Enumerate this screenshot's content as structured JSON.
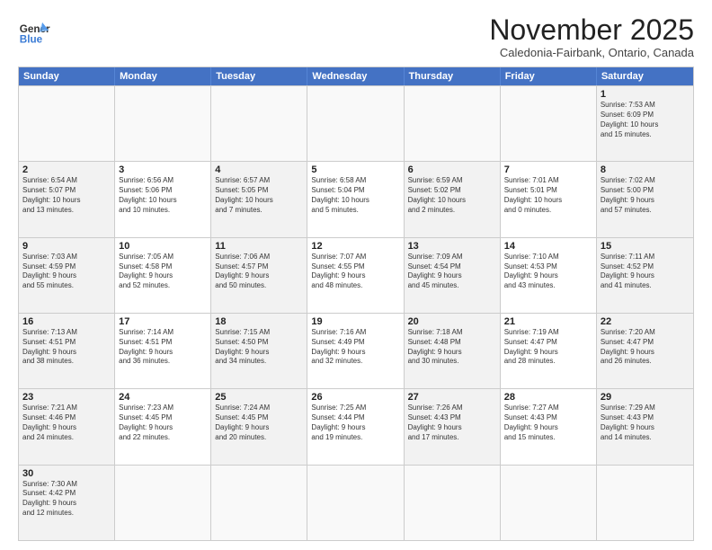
{
  "header": {
    "logo_general": "General",
    "logo_blue": "Blue",
    "month_title": "November 2025",
    "location": "Caledonia-Fairbank, Ontario, Canada"
  },
  "days_of_week": [
    "Sunday",
    "Monday",
    "Tuesday",
    "Wednesday",
    "Thursday",
    "Friday",
    "Saturday"
  ],
  "weeks": [
    [
      {
        "day": "",
        "info": "",
        "empty": true
      },
      {
        "day": "",
        "info": "",
        "empty": true
      },
      {
        "day": "",
        "info": "",
        "empty": true
      },
      {
        "day": "",
        "info": "",
        "empty": true
      },
      {
        "day": "",
        "info": "",
        "empty": true
      },
      {
        "day": "",
        "info": "",
        "empty": true
      },
      {
        "day": "1",
        "info": "Sunrise: 7:53 AM\nSunset: 6:09 PM\nDaylight: 10 hours\nand 15 minutes."
      }
    ],
    [
      {
        "day": "2",
        "info": "Sunrise: 6:54 AM\nSunset: 5:07 PM\nDaylight: 10 hours\nand 13 minutes."
      },
      {
        "day": "3",
        "info": "Sunrise: 6:56 AM\nSunset: 5:06 PM\nDaylight: 10 hours\nand 10 minutes."
      },
      {
        "day": "4",
        "info": "Sunrise: 6:57 AM\nSunset: 5:05 PM\nDaylight: 10 hours\nand 7 minutes."
      },
      {
        "day": "5",
        "info": "Sunrise: 6:58 AM\nSunset: 5:04 PM\nDaylight: 10 hours\nand 5 minutes."
      },
      {
        "day": "6",
        "info": "Sunrise: 6:59 AM\nSunset: 5:02 PM\nDaylight: 10 hours\nand 2 minutes."
      },
      {
        "day": "7",
        "info": "Sunrise: 7:01 AM\nSunset: 5:01 PM\nDaylight: 10 hours\nand 0 minutes."
      },
      {
        "day": "8",
        "info": "Sunrise: 7:02 AM\nSunset: 5:00 PM\nDaylight: 9 hours\nand 57 minutes."
      }
    ],
    [
      {
        "day": "9",
        "info": "Sunrise: 7:03 AM\nSunset: 4:59 PM\nDaylight: 9 hours\nand 55 minutes."
      },
      {
        "day": "10",
        "info": "Sunrise: 7:05 AM\nSunset: 4:58 PM\nDaylight: 9 hours\nand 52 minutes."
      },
      {
        "day": "11",
        "info": "Sunrise: 7:06 AM\nSunset: 4:57 PM\nDaylight: 9 hours\nand 50 minutes."
      },
      {
        "day": "12",
        "info": "Sunrise: 7:07 AM\nSunset: 4:55 PM\nDaylight: 9 hours\nand 48 minutes."
      },
      {
        "day": "13",
        "info": "Sunrise: 7:09 AM\nSunset: 4:54 PM\nDaylight: 9 hours\nand 45 minutes."
      },
      {
        "day": "14",
        "info": "Sunrise: 7:10 AM\nSunset: 4:53 PM\nDaylight: 9 hours\nand 43 minutes."
      },
      {
        "day": "15",
        "info": "Sunrise: 7:11 AM\nSunset: 4:52 PM\nDaylight: 9 hours\nand 41 minutes."
      }
    ],
    [
      {
        "day": "16",
        "info": "Sunrise: 7:13 AM\nSunset: 4:51 PM\nDaylight: 9 hours\nand 38 minutes."
      },
      {
        "day": "17",
        "info": "Sunrise: 7:14 AM\nSunset: 4:51 PM\nDaylight: 9 hours\nand 36 minutes."
      },
      {
        "day": "18",
        "info": "Sunrise: 7:15 AM\nSunset: 4:50 PM\nDaylight: 9 hours\nand 34 minutes."
      },
      {
        "day": "19",
        "info": "Sunrise: 7:16 AM\nSunset: 4:49 PM\nDaylight: 9 hours\nand 32 minutes."
      },
      {
        "day": "20",
        "info": "Sunrise: 7:18 AM\nSunset: 4:48 PM\nDaylight: 9 hours\nand 30 minutes."
      },
      {
        "day": "21",
        "info": "Sunrise: 7:19 AM\nSunset: 4:47 PM\nDaylight: 9 hours\nand 28 minutes."
      },
      {
        "day": "22",
        "info": "Sunrise: 7:20 AM\nSunset: 4:47 PM\nDaylight: 9 hours\nand 26 minutes."
      }
    ],
    [
      {
        "day": "23",
        "info": "Sunrise: 7:21 AM\nSunset: 4:46 PM\nDaylight: 9 hours\nand 24 minutes."
      },
      {
        "day": "24",
        "info": "Sunrise: 7:23 AM\nSunset: 4:45 PM\nDaylight: 9 hours\nand 22 minutes."
      },
      {
        "day": "25",
        "info": "Sunrise: 7:24 AM\nSunset: 4:45 PM\nDaylight: 9 hours\nand 20 minutes."
      },
      {
        "day": "26",
        "info": "Sunrise: 7:25 AM\nSunset: 4:44 PM\nDaylight: 9 hours\nand 19 minutes."
      },
      {
        "day": "27",
        "info": "Sunrise: 7:26 AM\nSunset: 4:43 PM\nDaylight: 9 hours\nand 17 minutes."
      },
      {
        "day": "28",
        "info": "Sunrise: 7:27 AM\nSunset: 4:43 PM\nDaylight: 9 hours\nand 15 minutes."
      },
      {
        "day": "29",
        "info": "Sunrise: 7:29 AM\nSunset: 4:43 PM\nDaylight: 9 hours\nand 14 minutes."
      }
    ],
    [
      {
        "day": "30",
        "info": "Sunrise: 7:30 AM\nSunset: 4:42 PM\nDaylight: 9 hours\nand 12 minutes."
      },
      {
        "day": "",
        "info": "",
        "empty": true
      },
      {
        "day": "",
        "info": "",
        "empty": true
      },
      {
        "day": "",
        "info": "",
        "empty": true
      },
      {
        "day": "",
        "info": "",
        "empty": true
      },
      {
        "day": "",
        "info": "",
        "empty": true
      },
      {
        "day": "",
        "info": "",
        "empty": true
      }
    ]
  ]
}
